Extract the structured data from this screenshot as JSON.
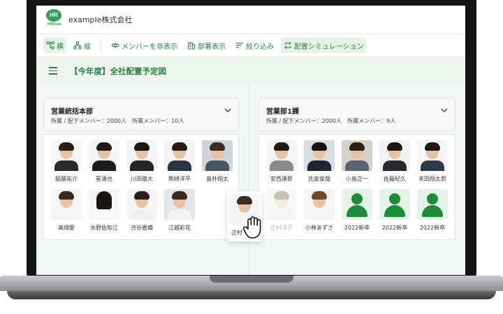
{
  "app": {
    "company": "example株式会社",
    "logo_text": "HR",
    "logo_sub": "HRBrain"
  },
  "toolbar": {
    "horizontal_label": "横",
    "vertical_label": "縦",
    "hide_members_label": "メンバーを非表示",
    "show_departments_label": "部署表示",
    "filter_label": "絞り込み",
    "simulation_label": "配置シミュレーション"
  },
  "page": {
    "title": "【今年度】全社配置予定図"
  },
  "departments": [
    {
      "name": "営業統括本部",
      "meta": "所属 / 配下メンバー：2000人　所属メンバー：10人",
      "members": [
        {
          "name": "稲葉祐介"
        },
        {
          "name": "星達也"
        },
        {
          "name": "川田雄大"
        },
        {
          "name": "熊崎洋平"
        },
        {
          "name": "島井翔太"
        },
        {
          "name": "高畑愛"
        },
        {
          "name": "水野佐知江"
        },
        {
          "name": "渋谷香織"
        },
        {
          "name": "江越彩花"
        }
      ]
    },
    {
      "name": "営業部1課",
      "meta": "所属 / 配下メンバー：2000人　所属メンバー：9人",
      "members": [
        {
          "name": "安西達郎"
        },
        {
          "name": "氏家俊哉"
        },
        {
          "name": "小島正一"
        },
        {
          "name": "佐藤紀久"
        },
        {
          "name": "末田翔太郎"
        },
        {
          "name": "正村洋子"
        },
        {
          "name": "小林あずさ"
        },
        {
          "name": "2022新卒"
        },
        {
          "name": "2022新卒"
        },
        {
          "name": "2022新卒"
        }
      ]
    }
  ],
  "dragged_member": {
    "name": "正村"
  },
  "colors": {
    "brand_green": "#2d7d46",
    "new_hire_green": "#1e8a3a"
  }
}
